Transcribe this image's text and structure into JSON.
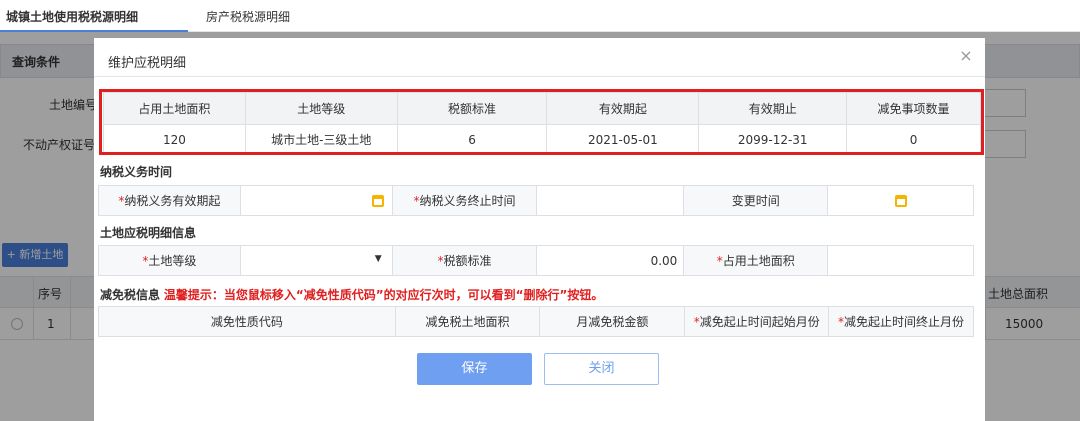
{
  "tabs": [
    "城镇土地使用税税源明细",
    "房产税税源明细"
  ],
  "background": {
    "query_title": "查询条件",
    "label_land_no": "土地编号",
    "label_property_cert": "不动产权证号",
    "add_land_button": "+ 新增土地",
    "grid_headers": {
      "seq": "序号",
      "total_area": "土地总面积"
    },
    "grid_row": {
      "seq": "1",
      "total_area": "15000"
    }
  },
  "modal": {
    "title": "维护应税明细",
    "summary": {
      "headers": [
        "占用土地面积",
        "土地等级",
        "税额标准",
        "有效期起",
        "有效期止",
        "减免事项数量"
      ],
      "values": [
        "120",
        "城市土地-三级土地",
        "6",
        "2021-05-01",
        "2099-12-31",
        "0"
      ]
    },
    "tax_period": {
      "section_title": "纳税义务时间",
      "start_label": "纳税义务有效期起",
      "end_label": "纳税义务终止时间",
      "change_label": "变更时间"
    },
    "detail": {
      "section_title": "土地应税明细信息",
      "grade_label": "土地等级",
      "rate_label": "税额标准",
      "rate_value": "0.00",
      "area_label": "占用土地面积"
    },
    "relief": {
      "section_title": "减免税信息",
      "tip": "温馨提示：当您鼠标移入“减免性质代码”的对应行次时，可以看到“删除行”按钮。",
      "columns": [
        "减免性质代码",
        "减免税土地面积",
        "月减免税金额",
        "减免起止时间起始月份",
        "减免起止时间终止月份"
      ]
    },
    "save_button": "保存",
    "close_button": "关闭"
  },
  "colors": {
    "accent": "#4a7fd8",
    "highlight_border": "#e02020",
    "required": "#e02020",
    "calendar_icon": "#f4b400"
  }
}
